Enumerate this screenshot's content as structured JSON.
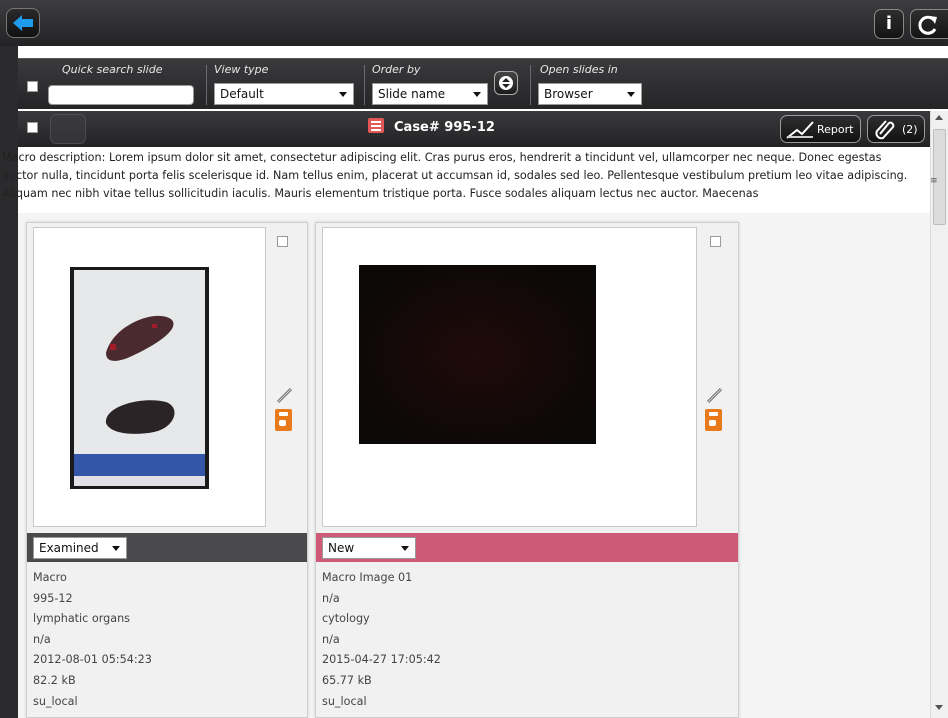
{
  "toolbar": {
    "back_icon": "back-arrow-icon",
    "info_label": "i",
    "refresh_icon": "refresh-icon"
  },
  "filters": {
    "quick_search": {
      "label": "Quick search slide",
      "value": ""
    },
    "view_type": {
      "label": "View type",
      "value": "Default"
    },
    "order_by": {
      "label": "Order by",
      "value": "Slide name"
    },
    "open_slides_in": {
      "label": "Open slides in",
      "value": "Browser"
    }
  },
  "case": {
    "title": "Case# 995-12",
    "report_label": "Report",
    "attachments_label": "(2)"
  },
  "description": "Macro description:  Lorem ipsum dolor sit amet, consectetur adipiscing elit. Cras purus eros, hendrerit a tincidunt vel, ullamcorper nec neque. Donec egestas auctor nulla, tincidunt porta felis scelerisque id. Nam tellus enim, placerat ut accumsan id, sodales sed leo. Pellentesque vestibulum pretium leo vitae adipiscing. Aliquam nec nibh vitae tellus sollicitudin iaculis. Mauris elementum tristique porta. Fusce sodales aliquam lectus nec auctor. Maecenas",
  "description_more": "≡",
  "slides": [
    {
      "status": "Examined",
      "status_color": "#4a4a4c",
      "name": "Macro",
      "case": "995-12",
      "tissue": "lymphatic organs",
      "stain": "n/a",
      "date": "2012-08-01 05:54:23",
      "size": "82.2 kB",
      "user": "su_local"
    },
    {
      "status": "New",
      "status_color": "#cf5a78",
      "name": "Macro Image 01",
      "case": "n/a",
      "tissue": "cytology",
      "stain": "n/a",
      "date": "2015-04-27 17:05:42",
      "size": "65.77 kB",
      "user": "su_local"
    }
  ]
}
